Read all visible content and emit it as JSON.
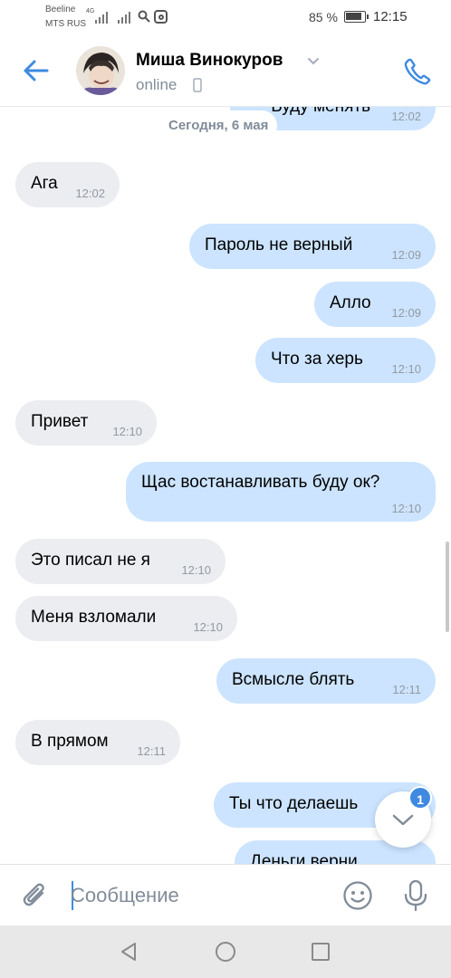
{
  "status_bar": {
    "carrier_1": "Beeline",
    "carrier_2": "MTS RUS",
    "network": "4G",
    "battery_percent": "85 %",
    "time": "12:15"
  },
  "header": {
    "contact_name": "Миша Винокуров",
    "status": "online",
    "accent_color": "#3f8ae0"
  },
  "chat": {
    "date_separator": "Сегодня, 6 мая",
    "messages": [
      {
        "direction": "out",
        "text": "Буду менять",
        "time": "12:02"
      },
      {
        "direction": "in",
        "text": "Ага",
        "time": "12:02"
      },
      {
        "direction": "out",
        "text": "Пароль не верный",
        "time": "12:09"
      },
      {
        "direction": "out",
        "text": "Алло",
        "time": "12:09"
      },
      {
        "direction": "out",
        "text": "Что за херь",
        "time": "12:10"
      },
      {
        "direction": "in",
        "text": "Привет",
        "time": "12:10"
      },
      {
        "direction": "out",
        "text": "Щас востанавливать буду ок?",
        "time": "12:10"
      },
      {
        "direction": "in",
        "text": "Это писал не я",
        "time": "12:10"
      },
      {
        "direction": "in",
        "text": "Меня взломали",
        "time": "12:10"
      },
      {
        "direction": "out",
        "text": "Всмысле блять",
        "time": "12:11"
      },
      {
        "direction": "in",
        "text": "В прямом",
        "time": "12:11"
      },
      {
        "direction": "out",
        "text": "Ты что делаешь",
        "time": ""
      },
      {
        "direction": "out",
        "text": "Деньги верни",
        "time": ""
      }
    ],
    "unread_count": "1"
  },
  "composer": {
    "placeholder": "Сообщение",
    "value": ""
  },
  "colors": {
    "outgoing_bubble": "#cce4ff",
    "incoming_bubble": "#ebedf0",
    "time_text": "#939aa3"
  }
}
